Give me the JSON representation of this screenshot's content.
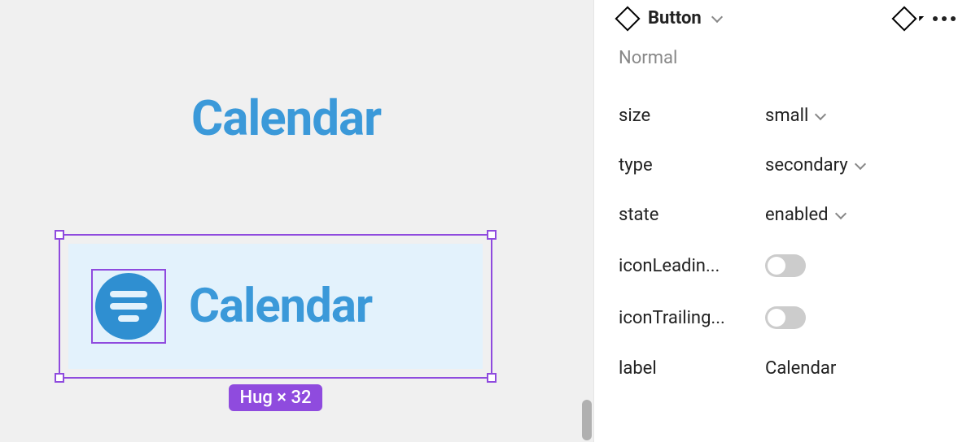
{
  "canvas": {
    "heading": "Calendar",
    "button_label": "Calendar",
    "size_tag": "Hug × 32"
  },
  "inspector": {
    "title": "Button",
    "state_label": "Normal",
    "props": {
      "size": {
        "name": "size",
        "value": "small"
      },
      "type": {
        "name": "type",
        "value": "secondary"
      },
      "state": {
        "name": "state",
        "value": "enabled"
      },
      "iconLeading": {
        "name": "iconLeadin...",
        "value": false
      },
      "iconTrailing": {
        "name": "iconTrailing...",
        "value": false
      },
      "label": {
        "name": "label",
        "value": "Calendar"
      }
    }
  }
}
